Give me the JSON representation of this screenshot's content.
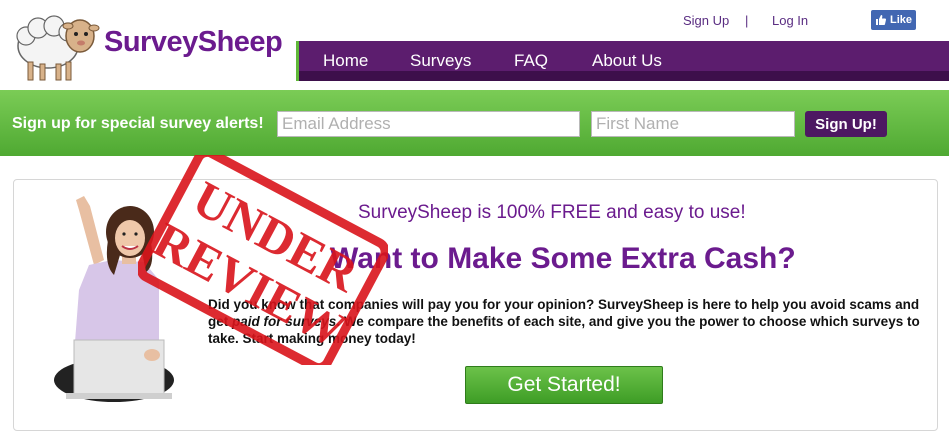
{
  "header": {
    "brand": "SurveySheep",
    "toplinks": {
      "signup": "Sign Up",
      "separator": "|",
      "login": "Log In"
    },
    "facebook_like": "Like",
    "nav": [
      "Home",
      "Surveys",
      "FAQ",
      "About Us"
    ]
  },
  "alert_bar": {
    "text": "Sign up for special survey alerts!",
    "email_placeholder": "Email Address",
    "name_placeholder": "First Name",
    "button": "Sign Up!"
  },
  "main": {
    "tagline": "SurveySheep is 100% FREE and easy to use!",
    "headline": "Want to Make Some Extra Cash?",
    "body_part1": "Did you know that companies will pay you for your opinion? SurveySheep is here to help you avoid scams and get ",
    "body_emphasis": "paid for surveys",
    "body_part2": ". We compare the benefits of each site, and give you the power to choose which surveys to take. Start making money today!",
    "cta": "Get Started!"
  },
  "stamp": {
    "line1": "UNDER",
    "line2": "REVIEW",
    "color": "#d9141b"
  },
  "colors": {
    "brand_purple": "#6b1b8e",
    "nav_purple": "#5c1d6e",
    "green": "#5fb838"
  },
  "icons": [
    "sheep-logo-icon",
    "facebook-thumb-icon"
  ]
}
